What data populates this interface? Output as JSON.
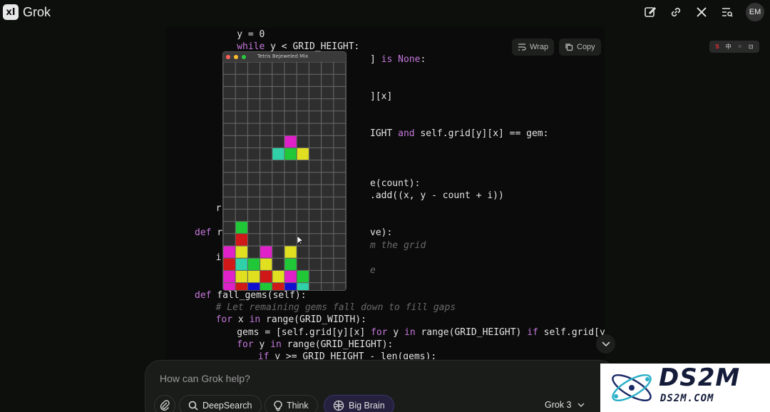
{
  "app": {
    "name": "Grok",
    "logo_text": "xI"
  },
  "user": {
    "initials": "EM"
  },
  "topbar_icons": [
    "edit-icon",
    "link-icon",
    "x-icon",
    "history-search-icon"
  ],
  "code_toolbar": {
    "wrap_label": "Wrap",
    "copy_label": "Copy"
  },
  "code": {
    "visible_lines": [
      {
        "indent": 8,
        "text": "y = 0"
      },
      {
        "indent": 8,
        "text": "while y < GRID_HEIGHT:"
      },
      {
        "indent": 0,
        "text": "] is None:"
      },
      {
        "indent": 0,
        "text": "][x]"
      },
      {
        "indent": 0,
        "text": "IGHT and self.grid[y][x] == gem:"
      },
      {
        "indent": 0,
        "text": "e(count):"
      },
      {
        "indent": 0,
        "text": ".add((x, y - count + i))"
      },
      {
        "indent": 4,
        "text": "r"
      },
      {
        "indent": 0,
        "text": "def r"
      },
      {
        "indent": 0,
        "text": "ve):"
      },
      {
        "indent": 0,
        "text": "m the grid"
      },
      {
        "indent": 4,
        "text": "i"
      },
      {
        "indent": 0,
        "text": "e"
      },
      {
        "indent": 0,
        "text": "def fall_gems(self):"
      },
      {
        "indent": 4,
        "text": "# Let remaining gems fall down to fill gaps"
      },
      {
        "indent": 4,
        "text": "for x in range(GRID_WIDTH):"
      },
      {
        "indent": 8,
        "text": "gems = [self.grid[y][x] for y in range(GRID_HEIGHT) if self.grid[y][x]"
      },
      {
        "indent": 8,
        "text": "for y in range(GRID_HEIGHT):"
      },
      {
        "indent": 12,
        "text": "if y >= GRID_HEIGHT - len(gems):"
      }
    ]
  },
  "game": {
    "title": "Tetris Bejeweled Mix",
    "cols": 10,
    "rows": 19,
    "colors": {
      "M": "#e020c8",
      "T": "#30d0a8",
      "G": "#20c838",
      "Y": "#e0e020",
      "R": "#d01818",
      "B": "#1010d0"
    },
    "cells": [
      [
        6,
        5,
        "M"
      ],
      [
        7,
        4,
        "T"
      ],
      [
        7,
        5,
        "G"
      ],
      [
        7,
        6,
        "Y"
      ],
      [
        13,
        1,
        "G"
      ],
      [
        14,
        1,
        "R"
      ],
      [
        15,
        0,
        "M"
      ],
      [
        15,
        1,
        "Y"
      ],
      [
        15,
        3,
        "M"
      ],
      [
        15,
        5,
        "Y"
      ],
      [
        16,
        0,
        "R"
      ],
      [
        16,
        1,
        "T"
      ],
      [
        16,
        2,
        "G"
      ],
      [
        16,
        3,
        "Y"
      ],
      [
        16,
        5,
        "G"
      ],
      [
        17,
        0,
        "M"
      ],
      [
        17,
        1,
        "Y"
      ],
      [
        17,
        2,
        "Y"
      ],
      [
        17,
        3,
        "R"
      ],
      [
        17,
        4,
        "Y"
      ],
      [
        17,
        5,
        "M"
      ],
      [
        17,
        6,
        "G"
      ],
      [
        18,
        0,
        "M"
      ],
      [
        18,
        1,
        "R"
      ],
      [
        18,
        2,
        "B"
      ],
      [
        18,
        3,
        "G"
      ],
      [
        18,
        4,
        "R"
      ],
      [
        18,
        5,
        "B"
      ],
      [
        18,
        6,
        "T"
      ]
    ]
  },
  "extension_bar": {
    "items": [
      "S",
      "中",
      "⁘",
      "⊡"
    ]
  },
  "composer": {
    "placeholder": "How can Grok help?",
    "buttons": [
      {
        "label": "DeepSearch",
        "icon": "search-icon"
      },
      {
        "label": "Think",
        "icon": "lightbulb-icon"
      },
      {
        "label": "Big Brain",
        "icon": "brain-icon"
      }
    ],
    "model": "Grok 3"
  },
  "watermark": {
    "title": "DS2M",
    "subtitle": "DS2M.COM"
  }
}
